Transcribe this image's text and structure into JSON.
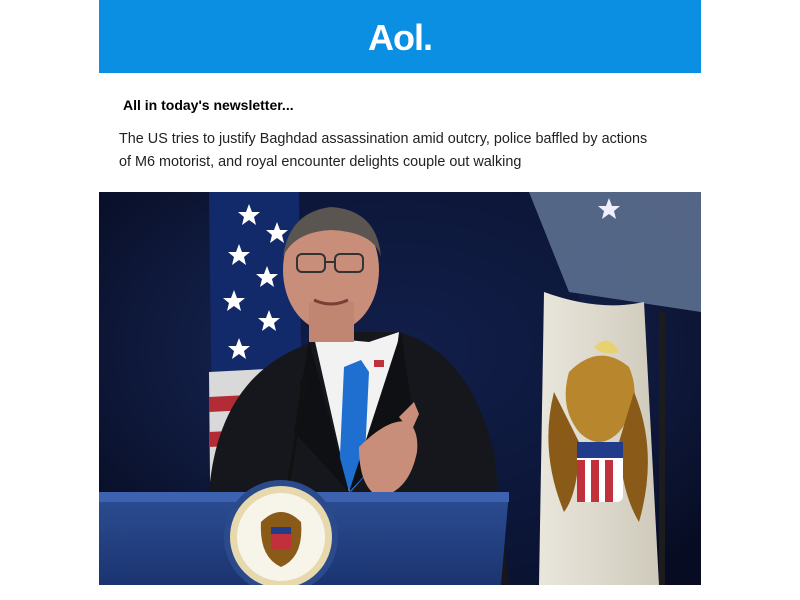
{
  "brand": {
    "logo_text": "Aol.",
    "color": "#0b8fe3"
  },
  "newsletter": {
    "heading": "All in today's newsletter...",
    "summary": "The US tries to justify Baghdad assassination amid outcry, police baffled by actions of M6 motorist, and royal encounter delights couple out walking"
  },
  "hero_image": {
    "subject": "speaker-at-podium-photo",
    "icon": "photo-icon"
  }
}
